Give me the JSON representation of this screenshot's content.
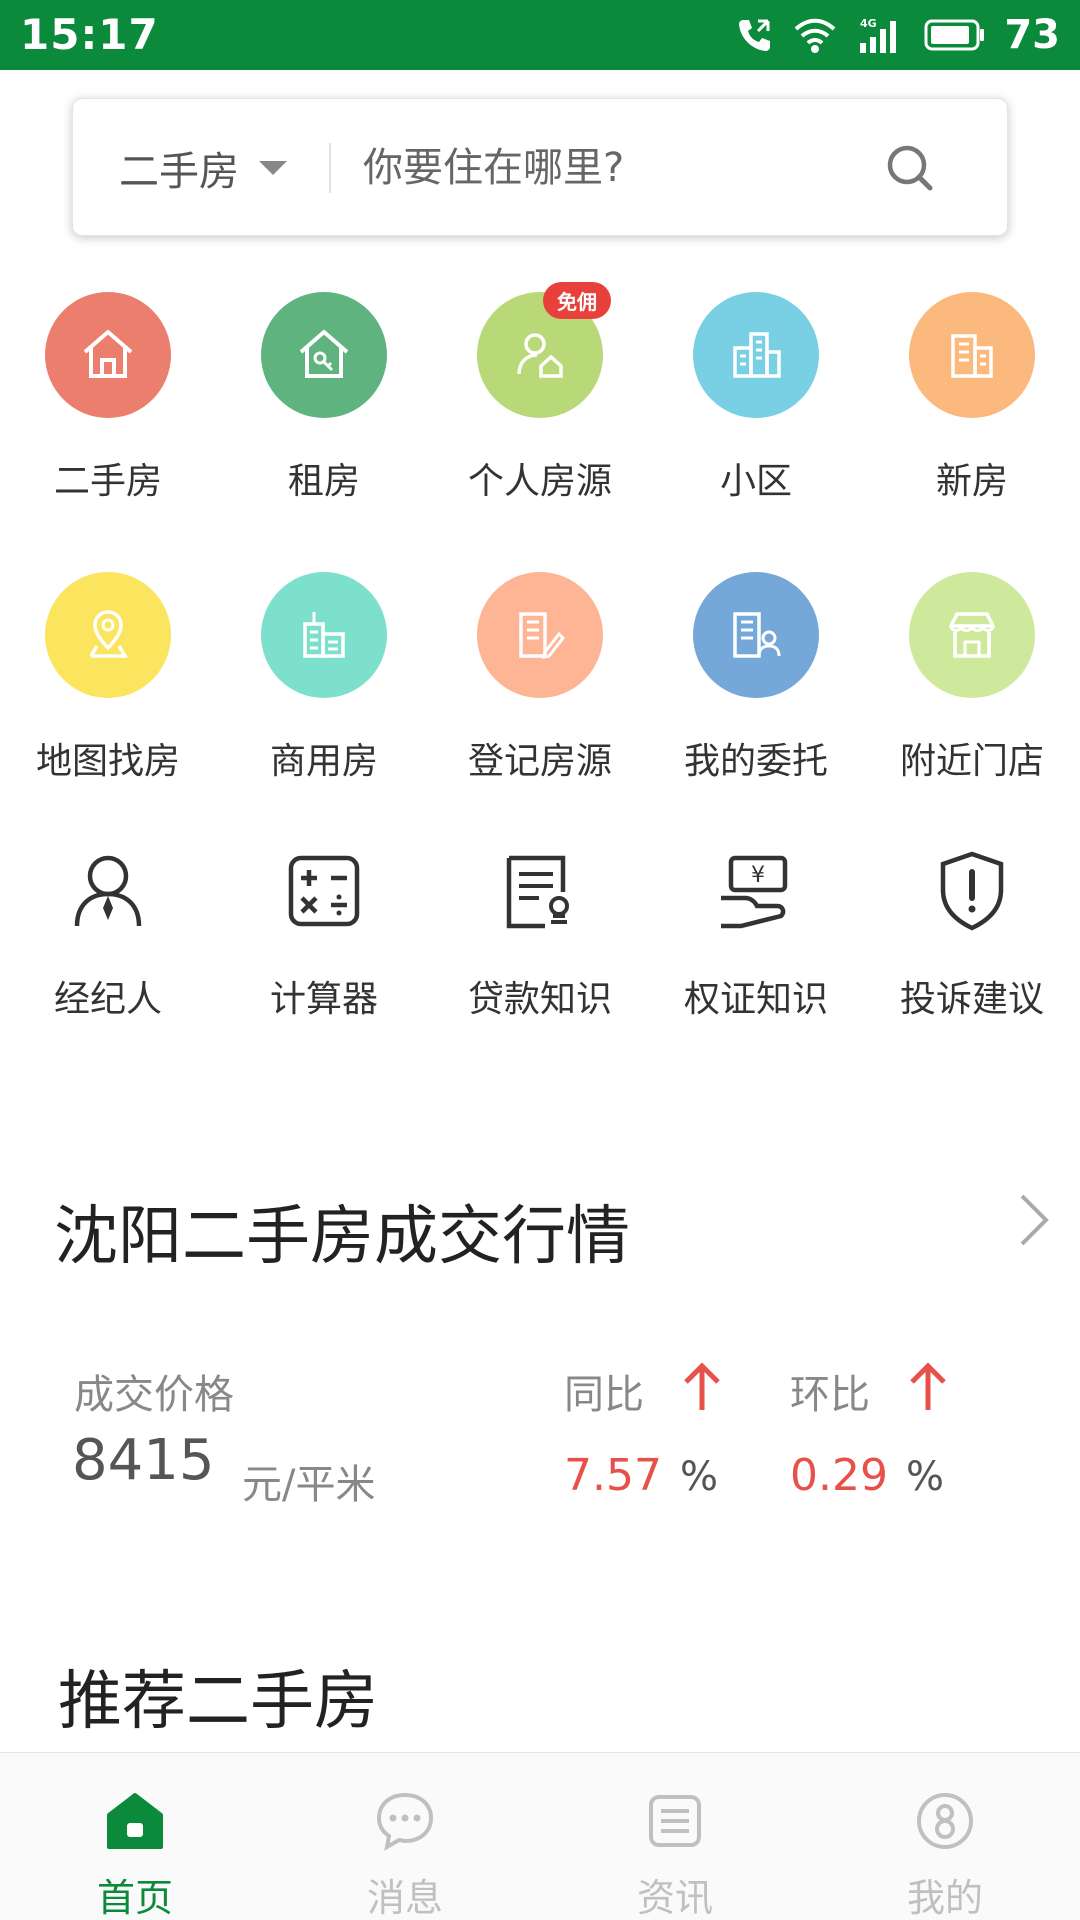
{
  "status_bar": {
    "time": "15:17",
    "network": "4G",
    "battery": "73"
  },
  "search": {
    "type_label": "二手房",
    "placeholder": "你要住在哪里?"
  },
  "grid": [
    {
      "label": "二手房",
      "icon": "house-icon",
      "color": "#ec7e6d"
    },
    {
      "label": "租房",
      "icon": "house-key-icon",
      "color": "#5fb37f"
    },
    {
      "label": "个人房源",
      "icon": "person-house-icon",
      "color": "#b9d877",
      "badge": "免佣"
    },
    {
      "label": "小区",
      "icon": "buildings-icon",
      "color": "#79cfe3"
    },
    {
      "label": "新房",
      "icon": "new-building-icon",
      "color": "#fcb97e"
    },
    {
      "label": "地图找房",
      "icon": "map-pin-icon",
      "color": "#fbe45e"
    },
    {
      "label": "商用房",
      "icon": "commercial-building-icon",
      "color": "#7de0cc"
    },
    {
      "label": "登记房源",
      "icon": "register-building-icon",
      "color": "#fdb595"
    },
    {
      "label": "我的委托",
      "icon": "entrust-building-icon",
      "color": "#75a7d8"
    },
    {
      "label": "附近门店",
      "icon": "store-icon",
      "color": "#cfe99c"
    }
  ],
  "tools": [
    {
      "label": "经纪人",
      "icon": "agent-icon"
    },
    {
      "label": "计算器",
      "icon": "calculator-icon"
    },
    {
      "label": "贷款知识",
      "icon": "loan-doc-icon"
    },
    {
      "label": "权证知识",
      "icon": "certificate-icon"
    },
    {
      "label": "投诉建议",
      "icon": "shield-alert-icon"
    }
  ],
  "market": {
    "title": "沈阳二手房成交行情",
    "price_label": "成交价格",
    "price_value": "8415",
    "price_unit": "元/平米",
    "yoy_label": "同比",
    "yoy_value": "7.57",
    "mom_label": "环比",
    "mom_value": "0.29",
    "percent_sign": "%",
    "trend_color": "#e8504a"
  },
  "recommend": {
    "title": "推荐二手房"
  },
  "bottom_nav": [
    {
      "label": "首页",
      "icon": "home-icon",
      "active": true
    },
    {
      "label": "消息",
      "icon": "message-icon",
      "active": false
    },
    {
      "label": "资讯",
      "icon": "news-icon",
      "active": false
    },
    {
      "label": "我的",
      "icon": "profile-icon",
      "active": false
    }
  ],
  "colors": {
    "brand_green": "#0a8a3a",
    "inactive_gray": "#c0c0c0"
  }
}
